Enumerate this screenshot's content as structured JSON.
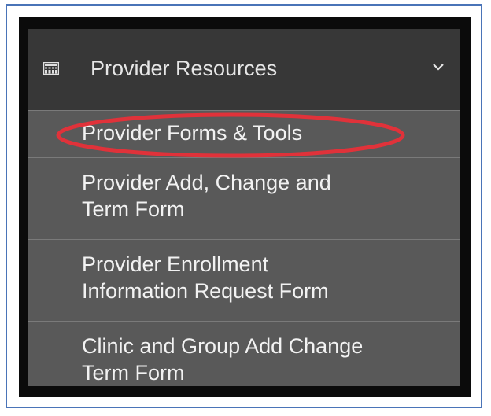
{
  "menu": {
    "header": {
      "title": "Provider Resources",
      "icon": "calculator-icon",
      "chevron_icon": "chevron-down-icon"
    },
    "items": [
      {
        "label": "Provider Forms & Tools",
        "highlighted": true
      },
      {
        "label": "Provider Add, Change and\nTerm Form"
      },
      {
        "label": "Provider Enrollment\nInformation Request Form"
      },
      {
        "label": "Clinic and Group Add Change\nTerm Form"
      }
    ]
  },
  "colors": {
    "frame_border": "#4a74b8",
    "menu_bg": "#0b0b0b",
    "header_bg": "#373737",
    "item_bg": "#595959",
    "highlight_oval": "#e0323a"
  }
}
